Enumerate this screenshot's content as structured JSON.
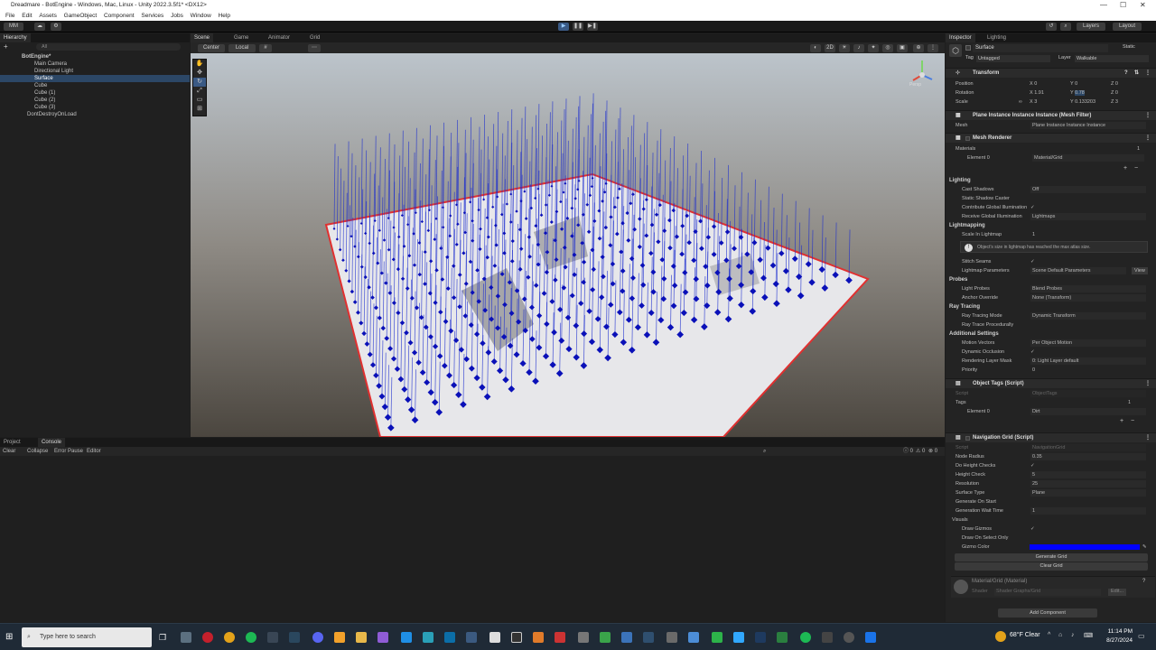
{
  "window": {
    "title": "Dreadmare - BotEngine - Windows, Mac, Linux - Unity 2022.3.5f1* <DX12>"
  },
  "menu": [
    "File",
    "Edit",
    "Assets",
    "GameObject",
    "Component",
    "Services",
    "Jobs",
    "Window",
    "Help"
  ],
  "toolbar": {
    "account": "MM",
    "layers": "Layers",
    "layout": "Layout"
  },
  "hierarchy": {
    "tab": "Hierarchy",
    "search_placeholder": "All",
    "items": [
      {
        "label": "BotEngine*"
      },
      {
        "label": "Main Camera"
      },
      {
        "label": "Directional Light"
      },
      {
        "label": "Surface"
      },
      {
        "label": "Cube"
      },
      {
        "label": "Cube (1)"
      },
      {
        "label": "Cube (2)"
      },
      {
        "label": "Cube (3)"
      },
      {
        "label": "DontDestroyOnLoad"
      }
    ]
  },
  "scene": {
    "tabs": [
      "Scene",
      "Game",
      "Animator",
      "Grid"
    ],
    "pivot": "Center",
    "space": "Local",
    "mode_2d": "2D",
    "persp": "Persp"
  },
  "console": {
    "tabs": [
      "Project",
      "Console"
    ],
    "toolbar": [
      "Clear",
      "Collapse",
      "Error Pause",
      "Editor"
    ],
    "counts": [
      "0",
      "0",
      "0"
    ]
  },
  "inspector": {
    "tabs": [
      "Inspector",
      "Lighting"
    ],
    "object_name": "Surface",
    "static_label": "Static",
    "tag_label": "Tag",
    "tag": "Untagged",
    "layer_label": "Layer",
    "layer": "Walkable",
    "transform": {
      "title": "Transform",
      "position": {
        "label": "Position",
        "x": "0",
        "y": "0",
        "z": "0"
      },
      "rotation": {
        "label": "Rotation",
        "x": "1.91",
        "y": "0.78",
        "z": "0"
      },
      "scale": {
        "label": "Scale",
        "x": "3",
        "y": "0.133203",
        "z": "3"
      }
    },
    "mesh_filter": {
      "title": "Plane Instance Instance Instance (Mesh Filter)",
      "mesh_label": "Mesh",
      "mesh": "Plane Instance Instance Instance"
    },
    "mesh_renderer": {
      "title": "Mesh Renderer",
      "materials_label": "Materials",
      "materials_count": "1",
      "element0_label": "Element 0",
      "element0": "Material/Grid",
      "lighting_label": "Lighting",
      "cast_shadows_label": "Cast Shadows",
      "cast_shadows": "Off",
      "static_shadow_label": "Static Shadow Caster",
      "contribute_gi_label": "Contribute Global Illumination",
      "receive_gi_label": "Receive Global Illumination",
      "receive_gi": "Lightmaps",
      "lightmapping_label": "Lightmapping",
      "scale_lightmap_label": "Scale In Lightmap",
      "scale_lightmap": "1",
      "warning": "Object's size in lightmap has reached the max atlas size.",
      "stitch_seams_label": "Stitch Seams",
      "lightmap_params_label": "Lightmap Parameters",
      "lightmap_params": "Scene Default Parameters",
      "view_btn": "View",
      "probes_label": "Probes",
      "light_probes_label": "Light Probes",
      "light_probes": "Blend Probes",
      "anchor_label": "Anchor Override",
      "anchor": "None (Transform)",
      "ray_label": "Ray Tracing",
      "ray_mode_label": "Ray Tracing Mode",
      "ray_mode": "Dynamic Transform",
      "procedural_label": "Ray Trace Procedurally",
      "additional_label": "Additional Settings",
      "motion_label": "Motion Vectors",
      "motion": "Per Object Motion",
      "occlusion_label": "Dynamic Occlusion",
      "rendering_layer_label": "Rendering Layer Mask",
      "rendering_layer": "0: Light Layer default",
      "priority_label": "Priority",
      "priority": "0"
    },
    "object_tags": {
      "title": "Object Tags (Script)",
      "script_label": "Script",
      "script": "ObjectTags",
      "tags_label": "Tags",
      "tags_count": "1",
      "element0_label": "Element 0",
      "element0": "Dirt"
    },
    "nav_grid": {
      "title": "Navigation Grid (Script)",
      "script_label": "Script",
      "script": "NavigationGrid",
      "node_radius_label": "Node Radius",
      "node_radius": "0.35",
      "height_checks_label": "Do Height Checks",
      "height_check_label": "Height Check",
      "height_check": "5",
      "resolution_label": "Resolution",
      "resolution": "25",
      "surface_type_label": "Surface Type",
      "surface_type": "Plane",
      "gen_start_label": "Generate On Start",
      "gen_wait_label": "Generation Wait Time",
      "gen_wait": "1",
      "visuals_label": "Visuals",
      "draw_gizmos_label": "Draw Gizmos",
      "draw_selected_label": "Draw On Select Only",
      "gizmo_color_label": "Gizmo Color",
      "gizmo_color": "#0000ff",
      "generate_btn": "Generate Grid",
      "clear_btn": "Clear Grid"
    },
    "material": {
      "title": "Material/Grid (Material)",
      "shader_label": "Shader",
      "shader": "Shader Graphs/Grid",
      "edit_btn": "Edit..."
    },
    "add_component": "Add Component"
  },
  "taskbar": {
    "search_placeholder": "Type here to search",
    "weather": "68°F  Clear",
    "time": "11:14 PM",
    "date": "8/27/2024"
  },
  "colors": {
    "accent": "#2c4766",
    "grid_blue": "#0000ff",
    "selection_red": "#e03030"
  }
}
